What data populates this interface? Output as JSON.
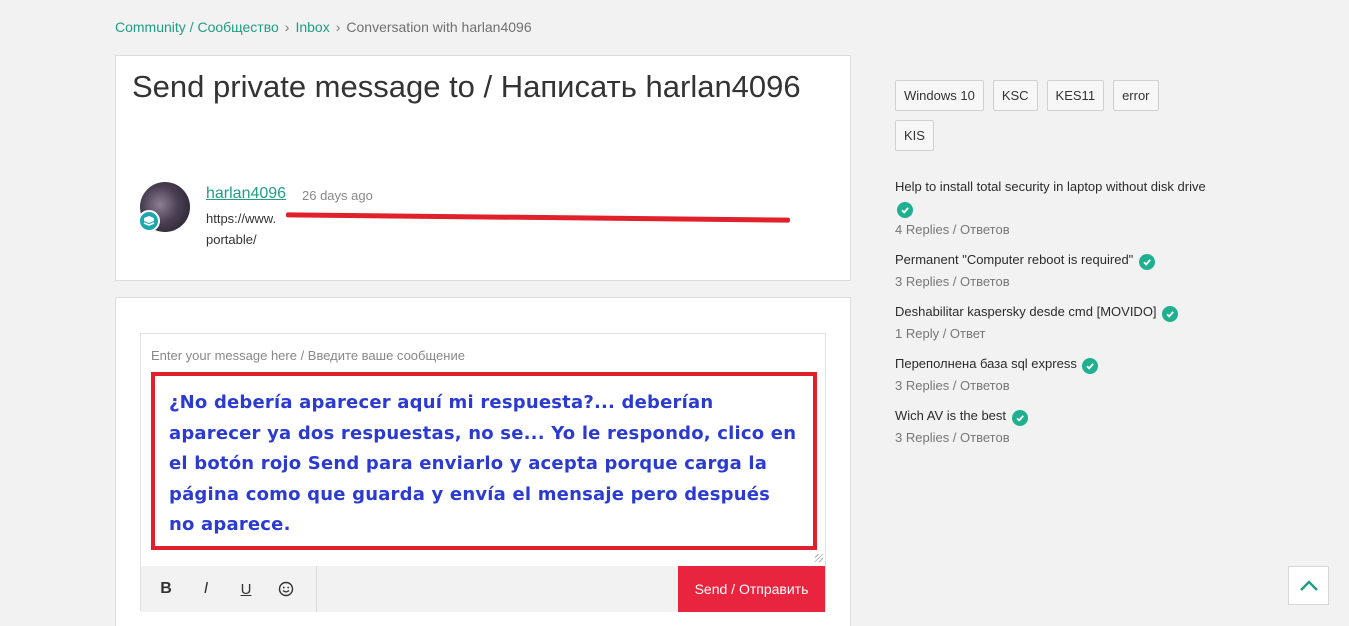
{
  "breadcrumb": {
    "community": "Community / Сообщество",
    "inbox": "Inbox",
    "current": "Conversation with harlan4096"
  },
  "page": {
    "title": "Send private message to / Написать harlan4096"
  },
  "message": {
    "author": "harlan4096",
    "time": "26 days ago",
    "body_line1": "https://www.",
    "body_line2": "portable/"
  },
  "editor": {
    "placeholder": "Enter your message here / Введите ваше сообщение",
    "annotation": "¿No debería aparecer aquí mi respuesta?... deberían aparecer ya dos respuestas, no se... Yo le respondo, clico en el botón rojo Send para enviarlo y acepta porque carga la página como que guarda y envía el mensaje pero después no aparece.",
    "toolbar": {
      "bold": "B",
      "italic": "I",
      "underline": "U"
    },
    "send_label": "Send / Отправить"
  },
  "tags": [
    "Windows 10",
    "KSC",
    "KES11",
    "error",
    "KIS"
  ],
  "related": [
    {
      "title": "Help to install total security in laptop without disk drive",
      "meta": "4 Replies / Ответов"
    },
    {
      "title": "Permanent \"Computer reboot is required\"",
      "meta": "3 Replies / Ответов"
    },
    {
      "title": "Deshabilitar kaspersky desde cmd [MOVIDO]",
      "meta": "1 Reply / Ответ"
    },
    {
      "title": "Переполнена база sql express",
      "meta": "3 Replies / Ответов"
    },
    {
      "title": "Wich AV is the best",
      "meta": "3 Replies / Ответов"
    }
  ],
  "colors": {
    "accent": "#1f9e86",
    "send_button": "#e8243e",
    "annotation_border": "#e0202a",
    "annotation_text": "#2b3bd1",
    "solved_check": "#1fb08f"
  }
}
